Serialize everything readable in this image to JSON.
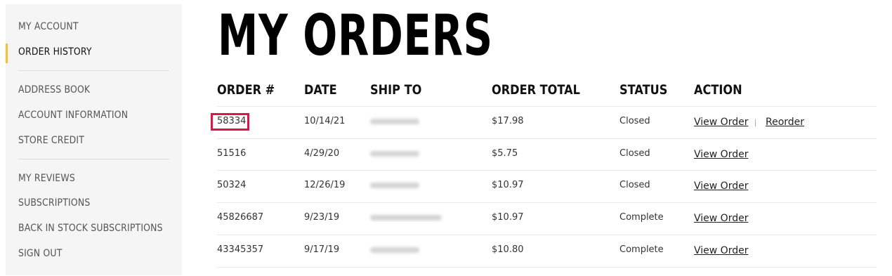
{
  "sidebar": {
    "items": [
      {
        "label": "MY ACCOUNT"
      },
      {
        "label": "ORDER HISTORY"
      },
      {
        "label": "ADDRESS BOOK"
      },
      {
        "label": "ACCOUNT INFORMATION"
      },
      {
        "label": "STORE CREDIT"
      },
      {
        "label": "MY REVIEWS"
      },
      {
        "label": "SUBSCRIPTIONS"
      },
      {
        "label": "BACK IN STOCK SUBSCRIPTIONS"
      },
      {
        "label": "SIGN OUT"
      }
    ],
    "active_color": "#f1c232"
  },
  "main": {
    "title": "MY ORDERS",
    "columns": {
      "order": "ORDER #",
      "date": "DATE",
      "ship_to": "SHIP TO",
      "total": "ORDER TOTAL",
      "status": "STATUS",
      "action": "ACTION"
    },
    "rows": [
      {
        "order": "58334",
        "date": "10/14/21",
        "total": "$17.98",
        "status": "Closed",
        "view": "View Order",
        "reorder": "Reorder",
        "sep": "|"
      },
      {
        "order": "51516",
        "date": "4/29/20",
        "total": "$5.75",
        "status": "Closed",
        "view": "View Order"
      },
      {
        "order": "50324",
        "date": "12/26/19",
        "total": "$10.97",
        "status": "Closed",
        "view": "View Order"
      },
      {
        "order": "45826687",
        "date": "9/23/19",
        "total": "$10.97",
        "status": "Complete",
        "view": "View Order"
      },
      {
        "order": "43345357",
        "date": "9/17/19",
        "total": "$10.80",
        "status": "Complete",
        "view": "View Order"
      }
    ],
    "highlight_color": "#e0144c"
  }
}
